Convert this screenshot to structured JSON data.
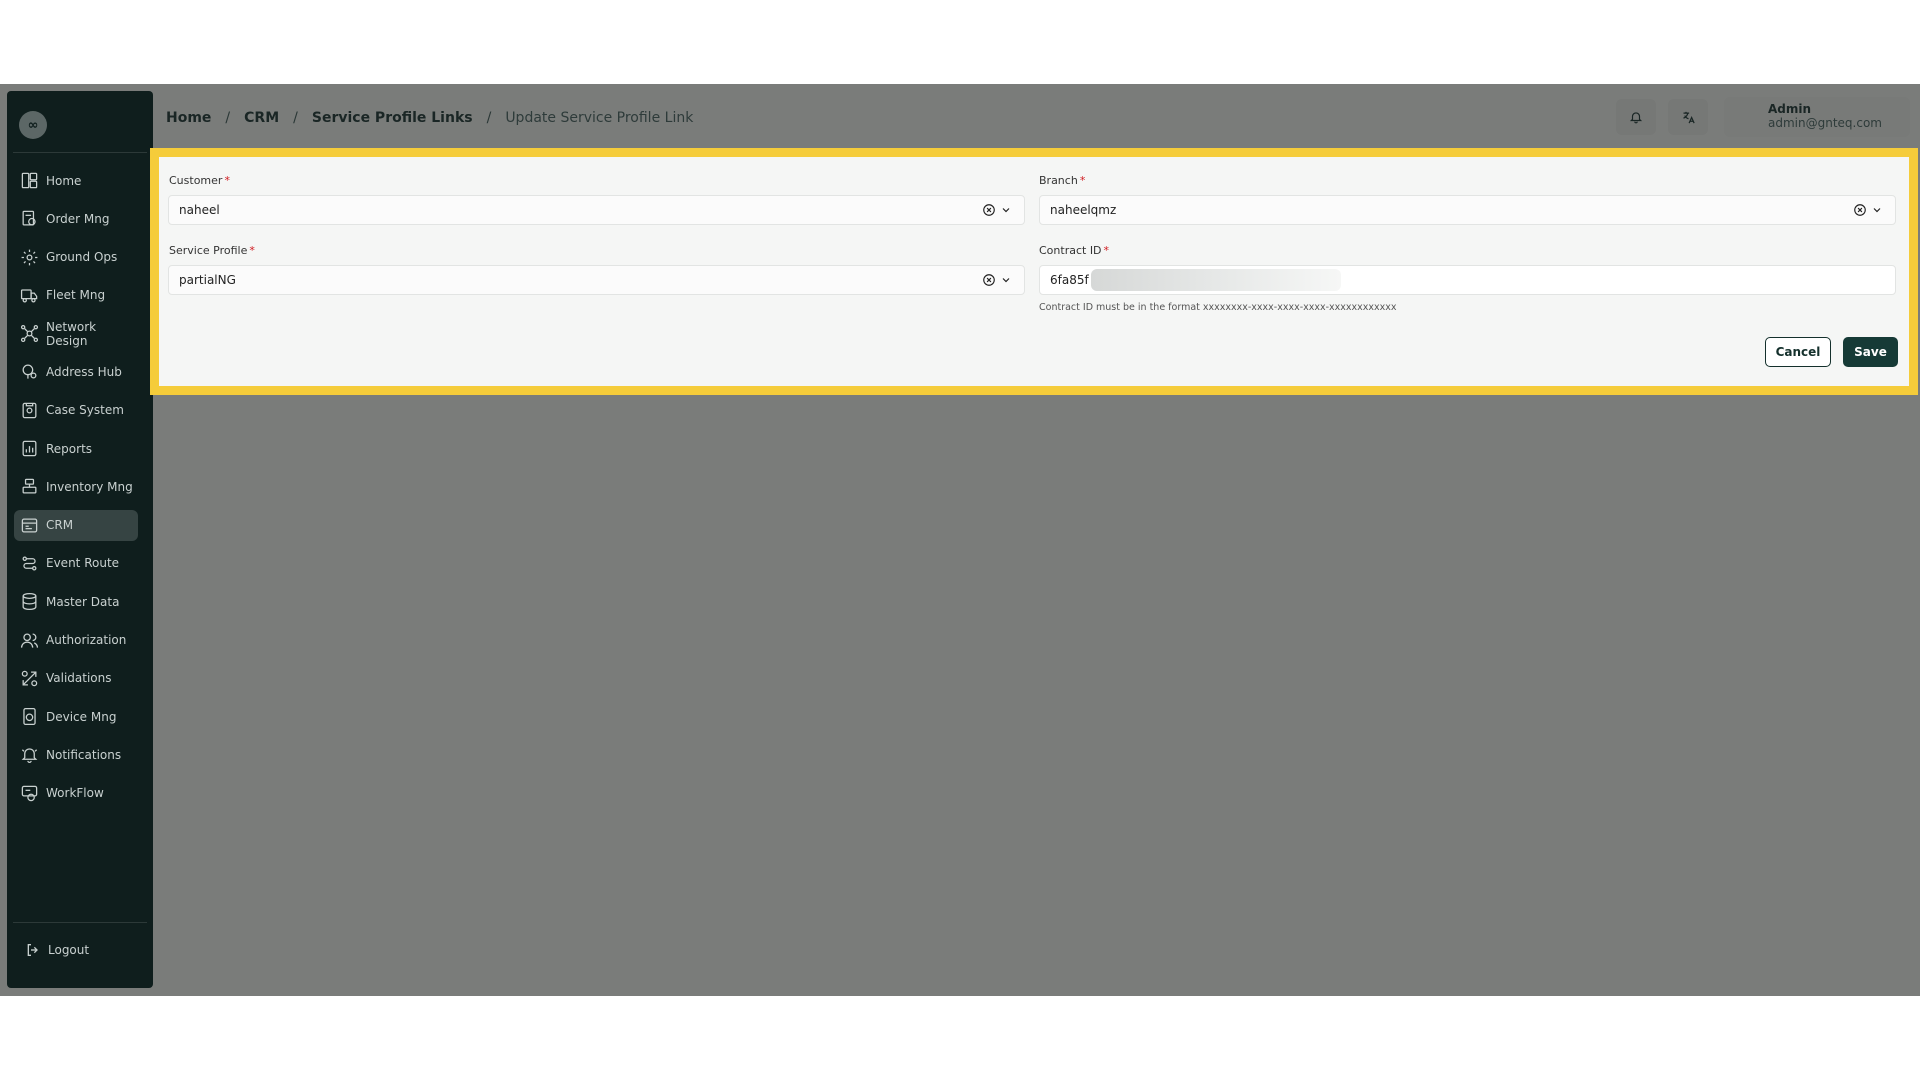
{
  "sidebar": {
    "logo_text": "∞",
    "items": [
      {
        "label": "Home",
        "icon": "home-icon"
      },
      {
        "label": "Order Mng",
        "icon": "order-icon"
      },
      {
        "label": "Ground Ops",
        "icon": "ground-ops-icon"
      },
      {
        "label": "Fleet Mng",
        "icon": "truck-icon"
      },
      {
        "label": "Network Design",
        "icon": "network-icon"
      },
      {
        "label": "Address Hub",
        "icon": "address-icon"
      },
      {
        "label": "Case System",
        "icon": "case-icon"
      },
      {
        "label": "Reports",
        "icon": "reports-icon"
      },
      {
        "label": "Inventory Mng",
        "icon": "inventory-icon"
      },
      {
        "label": "CRM",
        "icon": "crm-icon"
      },
      {
        "label": "Event Route",
        "icon": "route-icon"
      },
      {
        "label": "Master Data",
        "icon": "database-icon"
      },
      {
        "label": "Authorization",
        "icon": "users-icon"
      },
      {
        "label": "Validations",
        "icon": "validations-icon"
      },
      {
        "label": "Device Mng",
        "icon": "device-icon"
      },
      {
        "label": "Notifications",
        "icon": "bell-icon"
      },
      {
        "label": "WorkFlow",
        "icon": "workflow-icon"
      }
    ],
    "active": "CRM",
    "logout_label": "Logout"
  },
  "breadcrumb": [
    "Home",
    "CRM",
    "Service Profile Links",
    "Update Service Profile Link"
  ],
  "breadcrumb_separator": "/",
  "user": {
    "name": "Admin",
    "email": "admin@gnteq.com"
  },
  "form": {
    "customer": {
      "label": "Customer",
      "required_mark": "*",
      "value": "naheel"
    },
    "branch": {
      "label": "Branch",
      "required_mark": "*",
      "value": "naheelqmz"
    },
    "service_profile": {
      "label": "Service Profile",
      "required_mark": "*",
      "value": "partialNG"
    },
    "contract_id": {
      "label": "Contract ID",
      "required_mark": "*",
      "value": "6fa85f",
      "hint": "Contract ID must be in the format xxxxxxxx-xxxx-xxxx-xxxx-xxxxxxxxxxxx"
    },
    "cancel_label": "Cancel",
    "save_label": "Save"
  },
  "colors": {
    "highlight": "#f5cc3a",
    "primary": "#163a36",
    "sidebar": "#0f1e1d",
    "required": "#d0191e"
  }
}
